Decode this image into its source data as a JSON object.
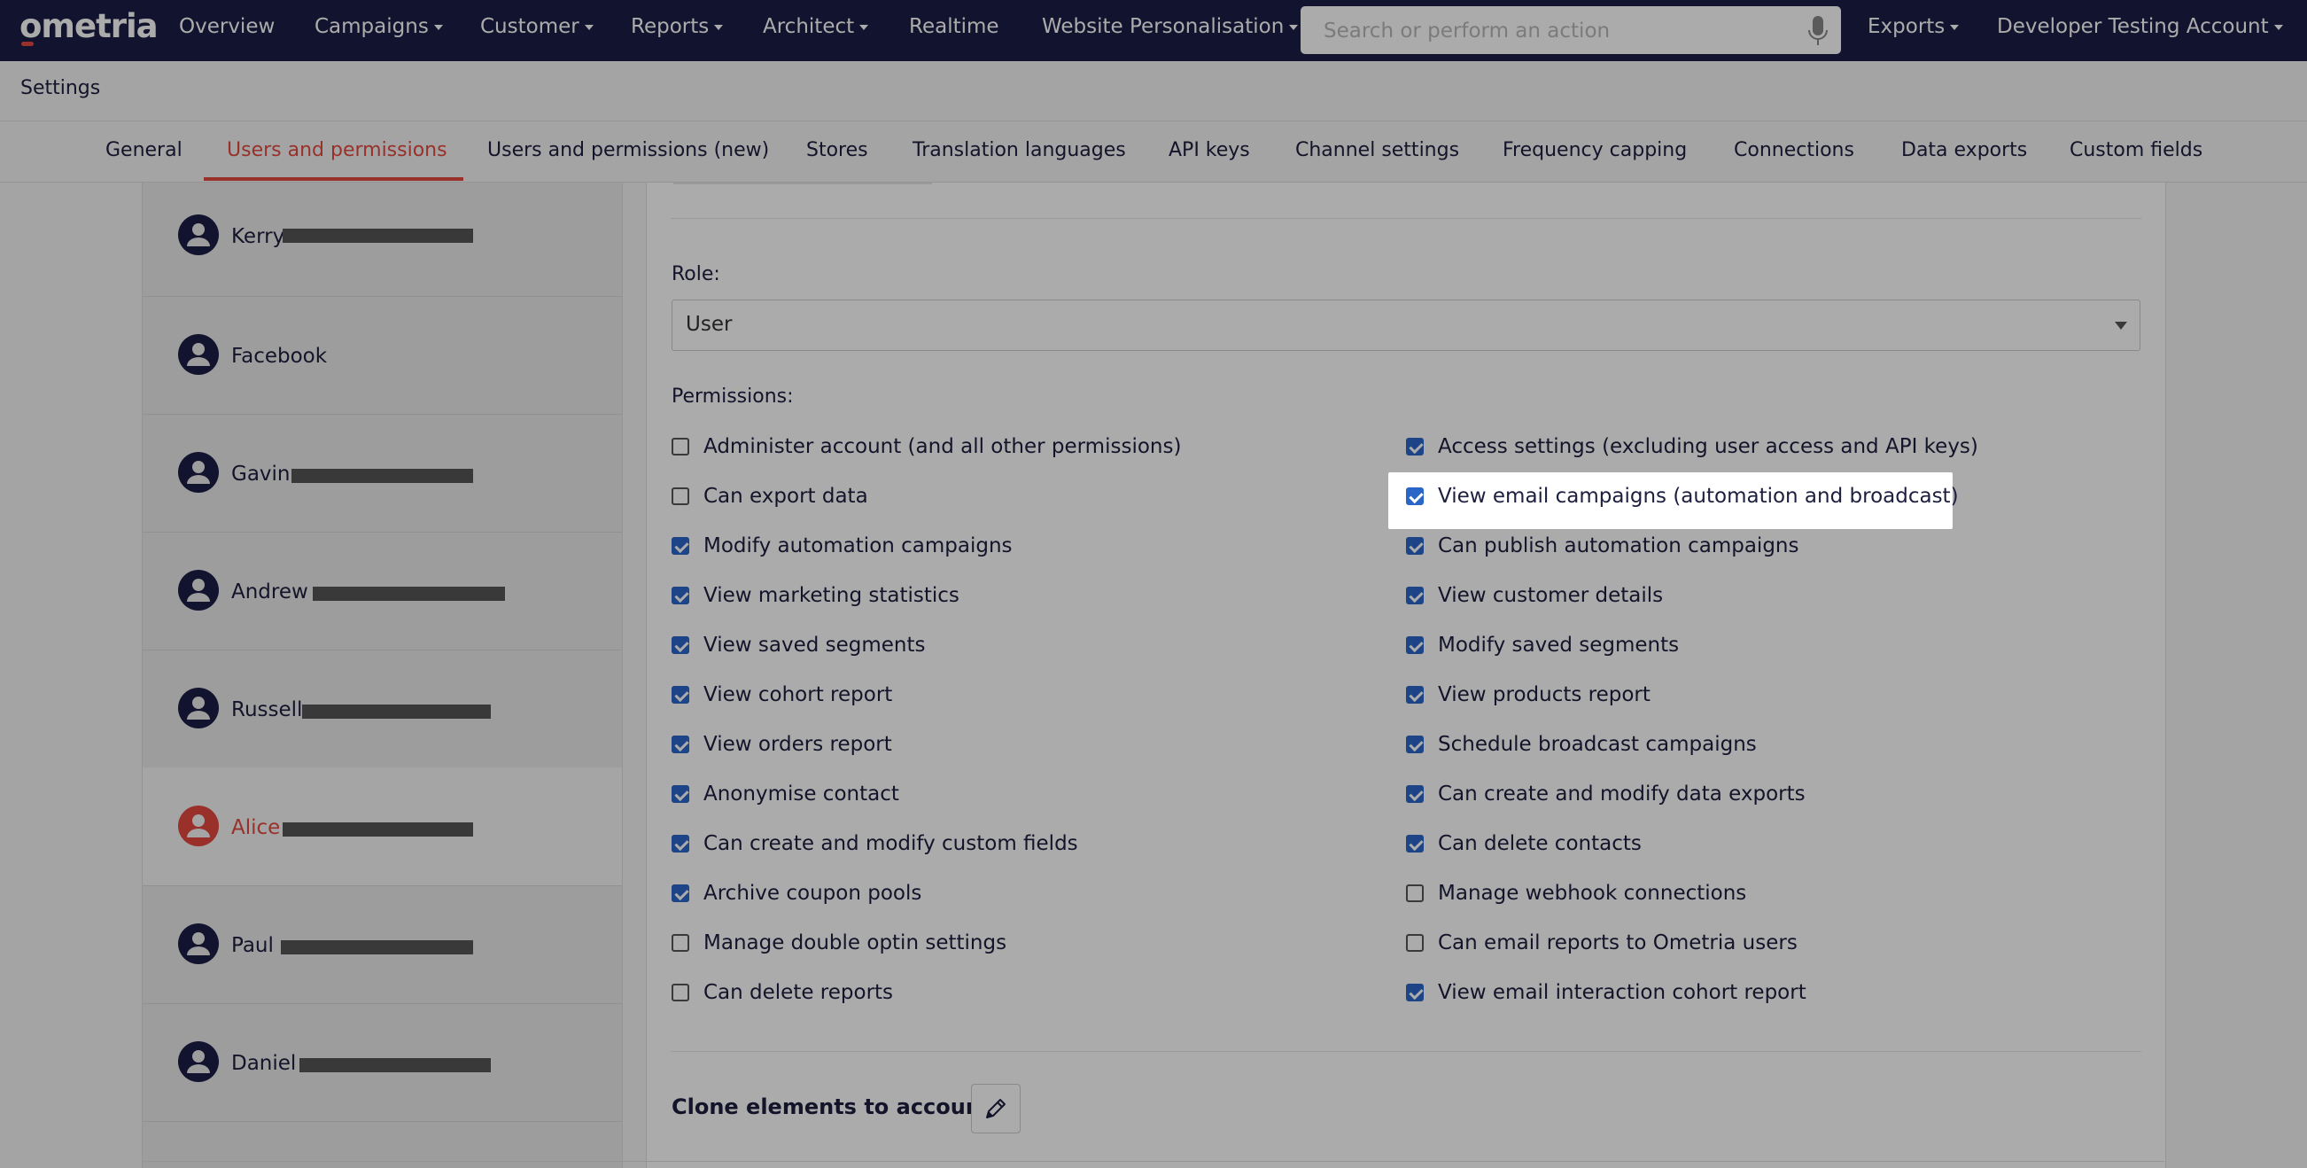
{
  "app": {
    "logo": "ometria",
    "nav": [
      {
        "label": "Overview",
        "dropdown": false
      },
      {
        "label": "Campaigns",
        "dropdown": true
      },
      {
        "label": "Customer",
        "dropdown": true
      },
      {
        "label": "Reports",
        "dropdown": true
      },
      {
        "label": "Architect",
        "dropdown": true
      },
      {
        "label": "Realtime",
        "dropdown": false
      },
      {
        "label": "Website Personalisation",
        "dropdown": true
      }
    ],
    "search_placeholder": "Search or perform an action",
    "exports_label": "Exports",
    "account_label": "Developer Testing Account"
  },
  "settings": {
    "title": "Settings",
    "tabs": [
      {
        "label": "General",
        "active": false
      },
      {
        "label": "Users and permissions",
        "active": true
      },
      {
        "label": "Users and permissions (new)",
        "active": false
      },
      {
        "label": "Stores",
        "active": false
      },
      {
        "label": "Translation languages",
        "active": false
      },
      {
        "label": "API keys",
        "active": false
      },
      {
        "label": "Channel settings",
        "active": false
      },
      {
        "label": "Frequency capping",
        "active": false
      },
      {
        "label": "Connections",
        "active": false
      },
      {
        "label": "Data exports",
        "active": false
      },
      {
        "label": "Custom fields",
        "active": false
      }
    ]
  },
  "users": [
    {
      "name": "Kerry",
      "selected": false
    },
    {
      "name": "Facebook",
      "selected": false
    },
    {
      "name": "Gavin",
      "selected": false
    },
    {
      "name": "Andrew",
      "selected": false
    },
    {
      "name": "Russell",
      "selected": false
    },
    {
      "name": "Alice",
      "selected": true
    },
    {
      "name": "Paul",
      "selected": false
    },
    {
      "name": "Daniel",
      "selected": false
    }
  ],
  "form": {
    "role_label": "Role:",
    "role_value": "User",
    "permissions_label": "Permissions:",
    "permissions_left": [
      {
        "label": "Administer account (and all other permissions)",
        "checked": false
      },
      {
        "label": "Can export data",
        "checked": false
      },
      {
        "label": "Modify automation campaigns",
        "checked": true
      },
      {
        "label": "View marketing statistics",
        "checked": true
      },
      {
        "label": "View saved segments",
        "checked": true
      },
      {
        "label": "View cohort report",
        "checked": true
      },
      {
        "label": "View orders report",
        "checked": true
      },
      {
        "label": "Anonymise contact",
        "checked": true
      },
      {
        "label": "Can create and modify custom fields",
        "checked": true
      },
      {
        "label": "Archive coupon pools",
        "checked": true
      },
      {
        "label": "Manage double optin settings",
        "checked": false
      },
      {
        "label": "Can delete reports",
        "checked": false
      }
    ],
    "permissions_right": [
      {
        "label": "Access settings (excluding user access and API keys)",
        "checked": true
      },
      {
        "label": "View email campaigns (automation and broadcast)",
        "checked": true
      },
      {
        "label": "Can publish automation campaigns",
        "checked": true
      },
      {
        "label": "View customer details",
        "checked": true
      },
      {
        "label": "Modify saved segments",
        "checked": true
      },
      {
        "label": "View products report",
        "checked": true
      },
      {
        "label": "Schedule broadcast campaigns",
        "checked": true
      },
      {
        "label": "Can create and modify data exports",
        "checked": true
      },
      {
        "label": "Can delete contacts",
        "checked": true
      },
      {
        "label": "Manage webhook connections",
        "checked": false
      },
      {
        "label": "Can email reports to Ometria users",
        "checked": false
      },
      {
        "label": "View email interaction cohort report",
        "checked": true
      }
    ],
    "clone_label": "Clone elements to accounts"
  },
  "icons": {
    "avatar": "user-avatar-icon",
    "mic": "microphone-icon",
    "edit": "pencil-icon"
  },
  "colors": {
    "nav_bg": "#1b1d45",
    "accent": "#e4483f",
    "checkbox": "#2a66c8"
  }
}
